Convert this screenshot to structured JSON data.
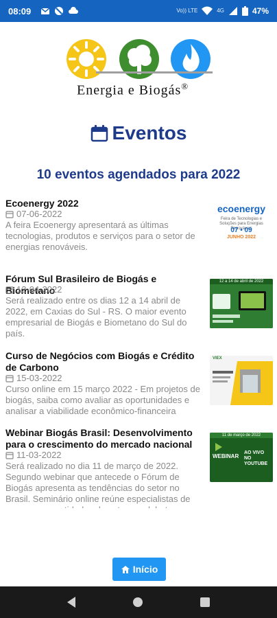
{
  "status_bar": {
    "time": "08:09",
    "network_label": "Vo)) LTE",
    "signal_label": "4G",
    "battery": "47%",
    "icons": [
      "gmail-icon",
      "blocked-icon",
      "cloud-icon",
      "wifi-icon",
      "signal-icon",
      "battery-icon"
    ]
  },
  "logo": {
    "text": "Energia e Biogás",
    "registered": "®"
  },
  "header": {
    "title": "Eventos",
    "subtitle": "10 eventos agendados para 2022"
  },
  "events": [
    {
      "title": "Ecoenergy 2022",
      "date": "07-06-2022",
      "description": "A feira Ecoenergy apresentará as últimas tecnologias, produtos e serviços para o setor de energias renováveis.",
      "thumb": {
        "brand": "ecoenergy",
        "tagline": "Feira de Tecnologias e Soluções para Energias Renováveis",
        "dates": "07 • 09",
        "month": "JUNHO 2022"
      }
    },
    {
      "title": "Fórum Sul Brasileiro de Biogás e Biometano",
      "date": "12-04-2022",
      "description": "Será realizado entre os dias 12 a 14 abril de 2022, em Caxias do Sul - RS. O maior evento empresarial de Biogás e Biometano do Sul do país.",
      "thumb": {
        "band": "12 a 14 de abril de 2022"
      }
    },
    {
      "title": "Curso de Negócios com Biogás e Crédito de Carbono",
      "date": "15-03-2022",
      "description": "Curso online em 15 março 2022 - Em projetos de biogás, saiba como avaliar as oportunidades e analisar a viabilidade econômico-financeira",
      "thumb": {
        "band": "VIEX"
      }
    },
    {
      "title": "Webinar Biogás Brasil: Desenvolvimento para o crescimento do mercado nacional",
      "date": "11-03-2022",
      "description": "Será realizado no dia 11 de março de 2022. Segundo webinar que antecede o Fórum de Biogás apresenta as tendências do setor no Brasil. Seminário online reúne especialistas de empresas e entidades do setor em debate",
      "thumb": {
        "band": "11 de março de 2022",
        "label": "WEBINAR",
        "live": "AO VIVO NO YOUTUBE"
      }
    }
  ],
  "footer": {
    "home_label": "Início"
  },
  "colors": {
    "status_bar": "#1565c0",
    "title": "#1e3a8a",
    "button": "#2196f3",
    "nav_bar": "#1a1a1a"
  }
}
